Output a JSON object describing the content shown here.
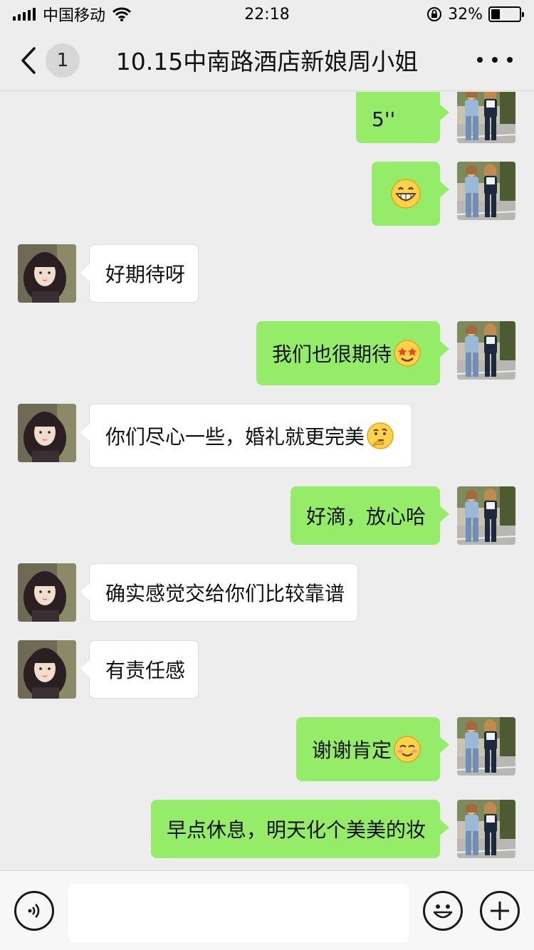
{
  "status_bar": {
    "carrier": "中国移动",
    "time": "22:18",
    "battery_percent": "32%",
    "battery_level": 0.32,
    "icons": [
      "signal-icon",
      "wifi-icon",
      "orientation-lock-icon",
      "battery-icon"
    ]
  },
  "nav": {
    "unread_count": "1",
    "title": "10.15中南路酒店新娘周小姐",
    "icons": [
      "back-chevron-icon",
      "more-icon"
    ]
  },
  "messages": [
    {
      "from": "me",
      "text": "5''",
      "emoji": null
    },
    {
      "from": "me",
      "text": "",
      "emoji": "grin-emoji"
    },
    {
      "from": "them",
      "text": "好期待呀",
      "emoji": null
    },
    {
      "from": "me",
      "text": "我们也很期待",
      "emoji": "star-struck-emoji"
    },
    {
      "from": "them",
      "text": "你们尽心一些，婚礼就更完美",
      "emoji": "thinking-emoji"
    },
    {
      "from": "me",
      "text": "好滴，放心哈",
      "emoji": null
    },
    {
      "from": "them",
      "text": "确实感觉交给你们比较靠谱",
      "emoji": null
    },
    {
      "from": "them",
      "text": "有责任感",
      "emoji": null
    },
    {
      "from": "me",
      "text": "谢谢肯定",
      "emoji": "blush-emoji"
    },
    {
      "from": "me",
      "text": "早点休息，明天化个美美的妆",
      "emoji": null
    }
  ],
  "input_bar": {
    "value": "",
    "placeholder": "",
    "icons": [
      "voice-icon",
      "emoji-icon",
      "plus-icon"
    ]
  },
  "colors": {
    "background": "#ededed",
    "bubble_me": "#95ec69",
    "bubble_them": "#ffffff"
  }
}
